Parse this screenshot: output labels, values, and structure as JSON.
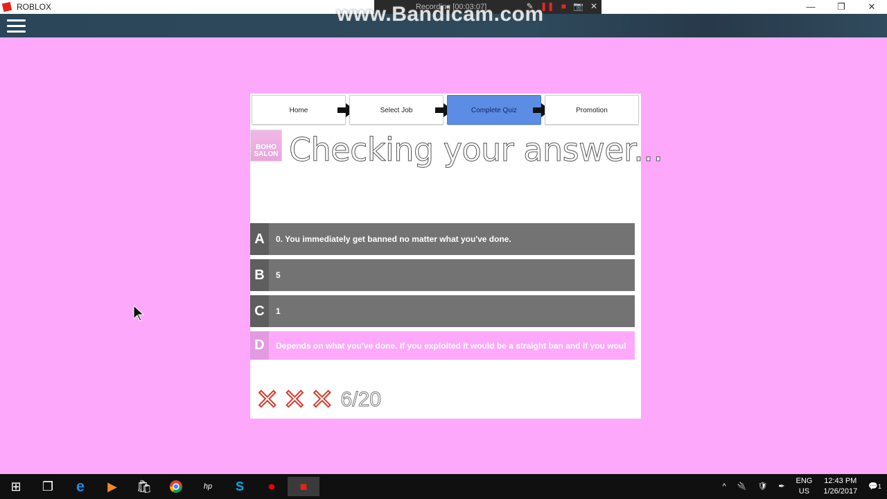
{
  "window": {
    "title": "ROBLOX",
    "controls": [
      "—",
      "❐",
      "✕"
    ]
  },
  "recorder": {
    "status": "Recording [00:03:07]",
    "watermark": "www.Bandicam.com"
  },
  "steps": [
    {
      "label": "Home",
      "active": false
    },
    {
      "label": "Select Job",
      "active": false
    },
    {
      "label": "Complete Quiz",
      "active": true
    },
    {
      "label": "Promotion",
      "active": false
    }
  ],
  "logo": {
    "line1": "BOHO",
    "line2": "SALON"
  },
  "headline": "Checking your answer...",
  "answers": [
    {
      "letter": "A",
      "text": "0. You immediately get banned no matter what you've done.",
      "selected": false
    },
    {
      "letter": "B",
      "text": "5",
      "selected": false
    },
    {
      "letter": "C",
      "text": "1",
      "selected": false
    },
    {
      "letter": "D",
      "text": "Depends on what you've done. If you exploited it would be a straight ban and if you woul",
      "selected": true
    }
  ],
  "score": {
    "strikes": 3,
    "strike_glyph": "✕",
    "progress": "6/20"
  },
  "taskbar": {
    "apps": [
      "windows-start",
      "task-view",
      "edge",
      "media-player",
      "store",
      "chrome",
      "hp",
      "skype",
      "bandicam",
      "roblox"
    ],
    "tray": {
      "language": "ENG",
      "region": "US",
      "time": "12:43 PM",
      "date": "1/26/2017",
      "notifications": "1"
    }
  },
  "colors": {
    "background": "#fda8fb",
    "active_step": "#5b8de4",
    "answer_bg": "#737373",
    "strike": "#d93a2b"
  }
}
